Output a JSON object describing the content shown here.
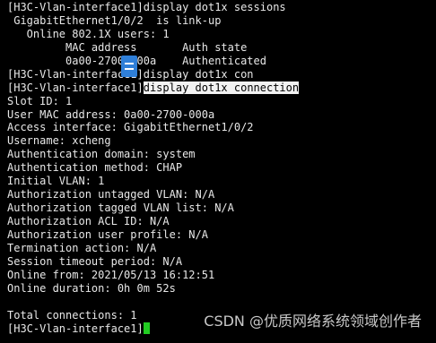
{
  "terminal": {
    "lines": [
      "[H3C-Vlan-interface1]display dot1x sessions",
      " GigabitEthernet1/0/2  is link-up",
      "   Online 802.1X users: 1",
      "         MAC address       Auth state",
      "         0a00-2700-000a    Authenticated",
      "[H3C-Vlan-interface1]display dot1x con",
      "",
      "Slot ID: 1",
      "User MAC address: 0a00-2700-000a",
      "Access interface: GigabitEthernet1/0/2",
      "Username: xcheng",
      "Authentication domain: system",
      "Authentication method: CHAP",
      "Initial VLAN: 1",
      "Authorization untagged VLAN: N/A",
      "Authorization tagged VLAN list: N/A",
      "Authorization ACL ID: N/A",
      "Authorization user profile: N/A",
      "Termination action: N/A",
      "Session timeout period: N/A",
      "Online from: 2021/05/13 16:12:51",
      "Online duration: 0h 0m 52s",
      "",
      "Total connections: 1"
    ],
    "highlighted_prompt": "[H3C-Vlan-interface1]",
    "highlighted_command": "display dot1x connection",
    "current_prompt": "[H3C-Vlan-interface1]"
  },
  "overlay": {
    "icon": "document-icon"
  },
  "watermark": {
    "text": "CSDN @优质网络系统领域创作者"
  },
  "colors": {
    "background": "#000000",
    "text": "#e8e8e8",
    "highlight_background": "#f2f2f2",
    "cursor": "#22cc22",
    "overlay_icon": "#2f7fd8"
  }
}
